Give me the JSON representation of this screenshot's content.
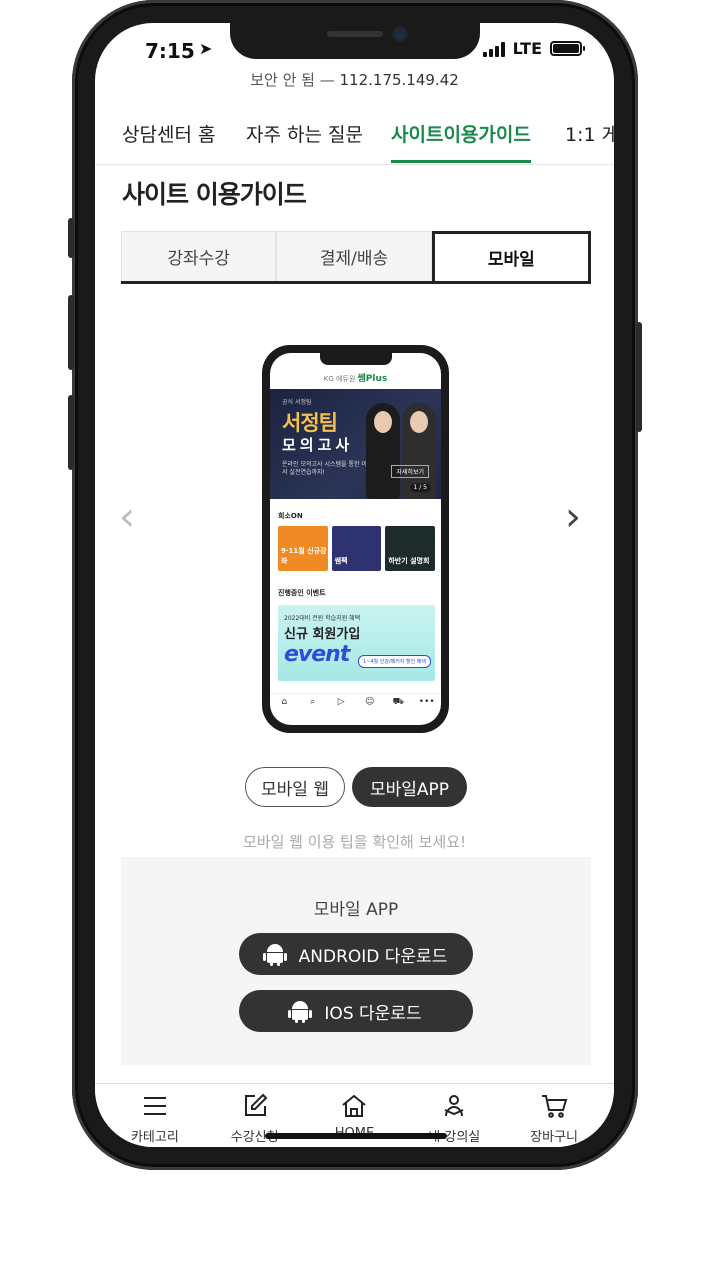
{
  "status": {
    "time": "7:15",
    "network": "LTE"
  },
  "url_bar": {
    "secure_text": "보안 안 됨 —",
    "address": "112.175.149.42"
  },
  "nav_tabs": [
    {
      "label": "상담센터 홈"
    },
    {
      "label": "자주 하는 질문"
    },
    {
      "label": "사이트이용가이드"
    },
    {
      "label": "1:1 게"
    }
  ],
  "page_title": "사이트 이용가이드",
  "segments": [
    {
      "label": "강좌수강"
    },
    {
      "label": "결제/배송"
    },
    {
      "label": "모바일"
    }
  ],
  "carousel": {
    "prev_icon": "chevron-left-icon",
    "next_icon": "chevron-right-icon",
    "preview": {
      "header_small": "KG 에듀원",
      "header_brand": "쌤Plus",
      "banner_small": "공식 서정팀",
      "banner_title": "서정팀",
      "banner_subtitle": "모의고사",
      "banner_desc": "온라인 모의고사 시스템을 통한 이론 점검에서 실전연습까지!",
      "banner_more": "자세히보기",
      "banner_pager": "1 / 5",
      "section1": "희소ON",
      "tiles": [
        "9·11월 신규강좌",
        "쌤팩",
        "하반기 설명회"
      ],
      "section2": "진행중인 이벤트",
      "event_line1": "2022대비 전원 학습지원 혜택",
      "event_line2": "신규 회원가입",
      "event_line3": "event",
      "event_pill": "1~4월 인강/패키지 할인 혜택"
    }
  },
  "mode_buttons": {
    "web": "모바일 웹",
    "app": "모바일APP"
  },
  "tip_text": "모바일 웹 이용 팁을 확인해 보세요!",
  "download": {
    "title": "모바일 APP",
    "android_label": "ANDROID 다운로드",
    "ios_label": "IOS 다운로드"
  },
  "tabbar": [
    {
      "label": "카테고리",
      "icon": "menu-icon"
    },
    {
      "label": "수강신청",
      "icon": "edit-icon"
    },
    {
      "label": "HOME",
      "icon": "home-icon"
    },
    {
      "label": "내 강의실",
      "icon": "learner-icon"
    },
    {
      "label": "장바구니",
      "icon": "cart-icon"
    }
  ]
}
